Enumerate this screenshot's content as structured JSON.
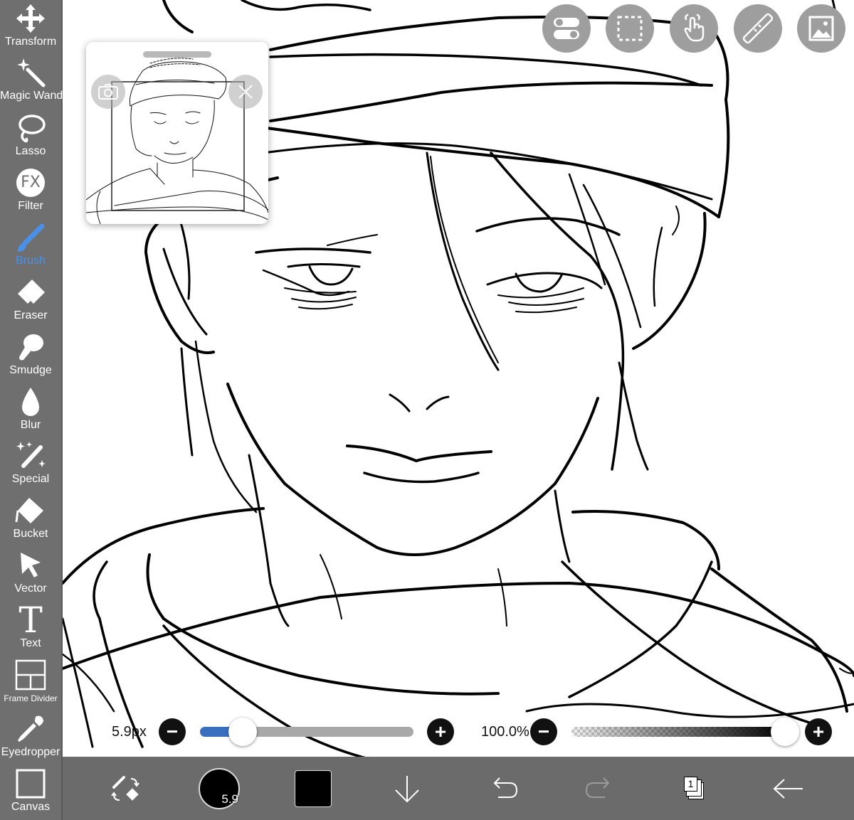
{
  "tools": [
    {
      "label": "Transform",
      "icon": "transform-arrows-icon"
    },
    {
      "label": "Magic Wand",
      "icon": "magic-wand-icon"
    },
    {
      "label": "Lasso",
      "icon": "lasso-icon"
    },
    {
      "label": "Filter",
      "icon": "fx-icon",
      "icon_text": "FX"
    },
    {
      "label": "Brush",
      "icon": "brush-icon",
      "active": true
    },
    {
      "label": "Eraser",
      "icon": "eraser-icon"
    },
    {
      "label": "Smudge",
      "icon": "smudge-icon"
    },
    {
      "label": "Blur",
      "icon": "blur-drop-icon"
    },
    {
      "label": "Special",
      "icon": "special-sparkle-pen-icon"
    },
    {
      "label": "Bucket",
      "icon": "bucket-icon"
    },
    {
      "label": "Vector",
      "icon": "vector-cursor-icon"
    },
    {
      "label": "Text",
      "icon": "text-icon",
      "icon_text": "T"
    },
    {
      "label": "Frame Divider",
      "icon": "frame-divider-icon"
    },
    {
      "label": "Eyedropper",
      "icon": "eyedropper-icon"
    },
    {
      "label": "Canvas",
      "icon": "canvas-icon"
    }
  ],
  "top_buttons": [
    "toggle-icon",
    "selection-icon",
    "touch-gesture-icon",
    "ruler-icon",
    "image-gallery-icon"
  ],
  "brush_size": {
    "label": "5.9px",
    "value_fraction": 0.2,
    "minus": "−",
    "plus": "+"
  },
  "opacity": {
    "label": "100.0%",
    "value_fraction": 1.0,
    "minus": "−",
    "plus": "+"
  },
  "bottom_toolbar": {
    "brush_size_badge": "5.9",
    "layer_count": "1",
    "color": "#000000"
  },
  "colors": {
    "accent": "#4a90e8",
    "toolbar": "#6f6f6f",
    "size_fill": "#3a6fc0"
  }
}
